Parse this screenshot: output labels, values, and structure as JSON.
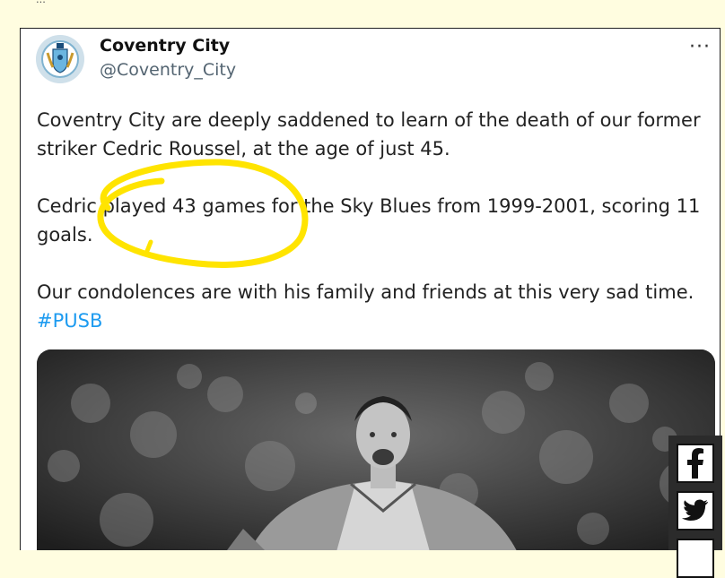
{
  "account": {
    "name": "Coventry City",
    "handle": "@Coventry_City",
    "avatar_icon": "club-crest-icon",
    "more_label": "···"
  },
  "tweet": {
    "paragraph_1": "Coventry City are deeply saddened to learn of the death of our former striker Cedric Roussel, at the age of just 45.",
    "paragraph_2": "Cedric played 43 games for the Sky Blues from 1999-2001, scoring 11 goals.",
    "paragraph_3": "Our condolences are with his family and friends at this very sad time.",
    "hashtag": "#PUSB"
  },
  "share": {
    "facebook_icon": "facebook-icon",
    "twitter_icon": "twitter-icon"
  },
  "colors": {
    "highlight": "#ffe400",
    "hashtag": "#1d9bf0",
    "page_background": "#fffde0"
  }
}
